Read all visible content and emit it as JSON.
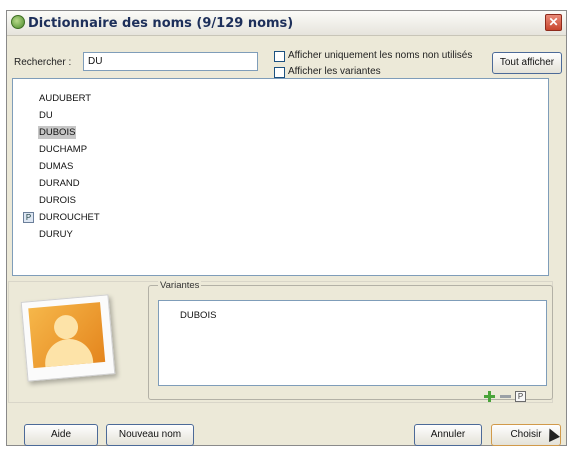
{
  "window": {
    "title": "Dictionnaire des noms (9/129 noms)",
    "close_symbol": "✕"
  },
  "search": {
    "label": "Rechercher :",
    "value": "DU"
  },
  "options": {
    "unused_only_label": "Afficher uniquement les noms non utilisés",
    "unused_only_checked": false,
    "show_variants_label": "Afficher les variantes",
    "show_variants_checked": false,
    "show_all_button": "Tout afficher"
  },
  "names": [
    {
      "text": "AUDUBERT",
      "selected": false,
      "icon": ""
    },
    {
      "text": "DU",
      "selected": false,
      "icon": ""
    },
    {
      "text": "DUBOIS",
      "selected": true,
      "icon": ""
    },
    {
      "text": "DUCHAMP",
      "selected": false,
      "icon": ""
    },
    {
      "text": "DUMAS",
      "selected": false,
      "icon": ""
    },
    {
      "text": "DURAND",
      "selected": false,
      "icon": ""
    },
    {
      "text": "DUROIS",
      "selected": false,
      "icon": ""
    },
    {
      "text": "DUROUCHET",
      "selected": false,
      "icon": "P"
    },
    {
      "text": "DURUY",
      "selected": false,
      "icon": ""
    }
  ],
  "variants": {
    "group_label": "Variantes",
    "items": [
      "DUBOIS"
    ],
    "p_icon_text": "P"
  },
  "footer": {
    "help_button": "Aide",
    "new_name_button": "Nouveau nom",
    "cancel_button": "Annuler",
    "choose_button": "Choisir"
  },
  "colors": {
    "selection": "#c6c6c6",
    "title_text": "#1d2f5a",
    "close_button": "#c8452c",
    "add_icon": "#4aa43a"
  },
  "icons": [
    "app-icon",
    "close-icon",
    "avatar-icon",
    "plus-icon",
    "minus-icon",
    "p-icon",
    "cursor-icon"
  ]
}
